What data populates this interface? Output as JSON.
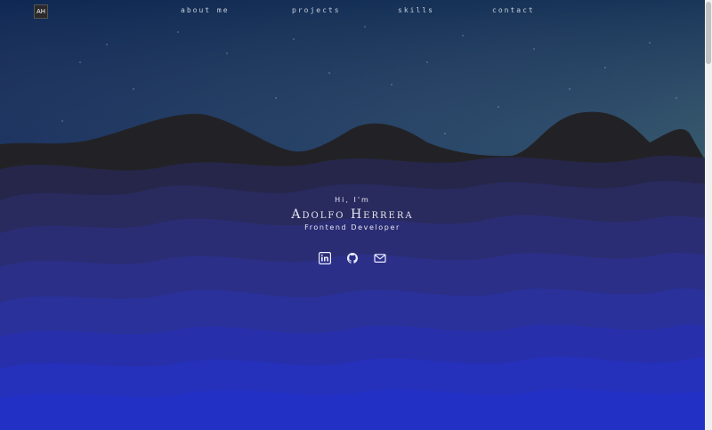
{
  "nav": {
    "logo": "AH",
    "links": [
      "about me",
      "projects",
      "skills",
      "contact"
    ]
  },
  "hero": {
    "greeting": "Hi, I'm",
    "name": "Adolfo Herrera",
    "role": "Frontend Developer"
  },
  "socials": [
    {
      "icon": "linkedin-icon"
    },
    {
      "icon": "github-icon"
    },
    {
      "icon": "mail-icon"
    }
  ],
  "colors": {
    "sky_top": "#16295a",
    "sky_right": "#1f4a44",
    "mountain": "#242428",
    "wave_bottom": "#2227c8"
  }
}
